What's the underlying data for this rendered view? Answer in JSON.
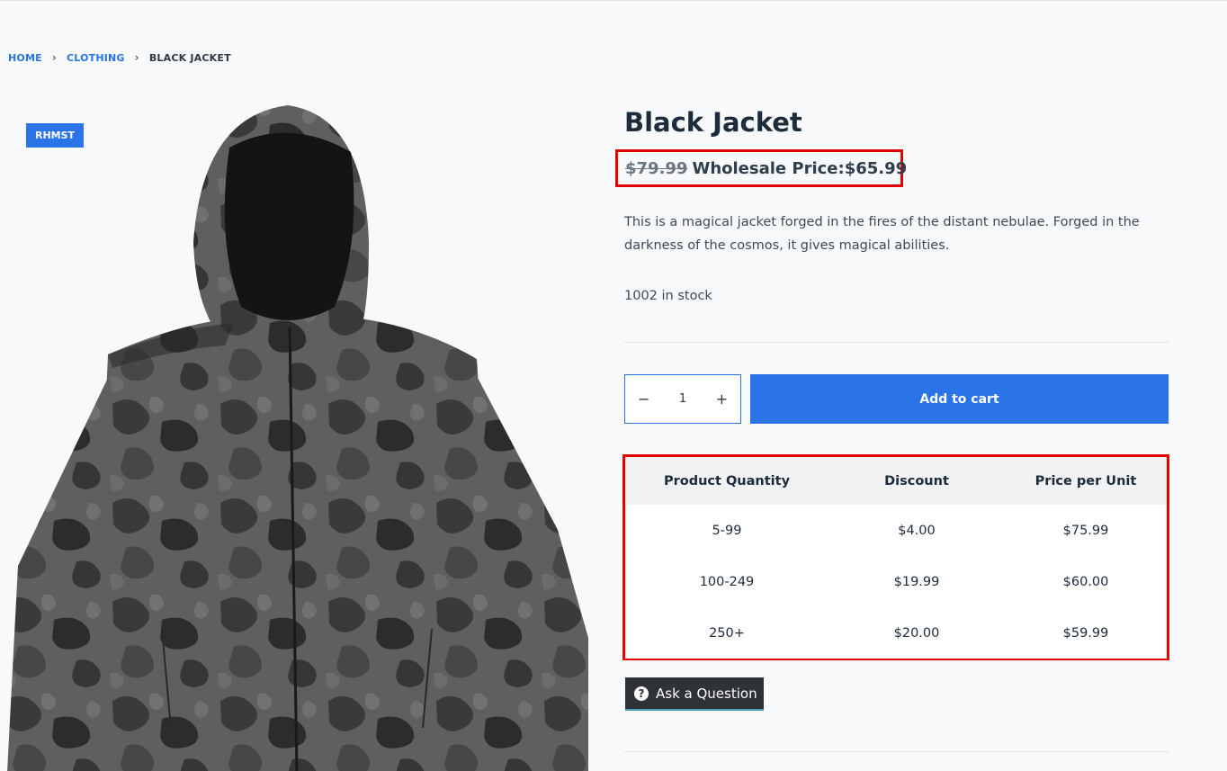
{
  "breadcrumb": {
    "home": "HOME",
    "category": "CLOTHING",
    "current": "BLACK JACKET",
    "separator": "›"
  },
  "product": {
    "badge": "RHMST",
    "title": "Black Jacket",
    "old_price": "$79.99",
    "wholesale_price": "Wholesale Price:$65.99",
    "description": "This is a magical jacket forged in the fires of the distant nebulae. Forged in the darkness of the cosmos, it gives magical abilities.",
    "stock": "1002 in stock",
    "image_icon": "hooded-jacket-camo-image"
  },
  "cart": {
    "minus": "−",
    "quantity": "1",
    "plus": "+",
    "add_label": "Add to cart"
  },
  "pricing_table": {
    "headers": [
      "Product Quantity",
      "Discount",
      "Price per Unit"
    ],
    "rows": [
      [
        "5-99",
        "$4.00",
        "$75.99"
      ],
      [
        "100-249",
        "$19.99",
        "$60.00"
      ],
      [
        "250+",
        "$20.00",
        "$59.99"
      ]
    ]
  },
  "ask": {
    "icon": "question-icon",
    "glyph": "?",
    "label": "Ask a Question"
  },
  "colors": {
    "accent": "#2a74e8",
    "highlight": "#e30000",
    "dark_button": "#2f3337"
  }
}
